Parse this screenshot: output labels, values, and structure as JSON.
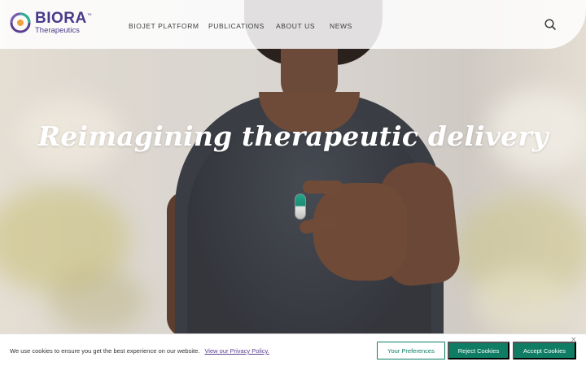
{
  "brand": {
    "name": "BIORA",
    "subtitle": "Therapeutics",
    "trademark": "™"
  },
  "nav": {
    "items": [
      {
        "label": "BIOJET PLATFORM"
      },
      {
        "label": "PUBLICATIONS"
      },
      {
        "label": "ABOUT US"
      },
      {
        "label": "NEWS"
      }
    ],
    "search_icon": "search-icon"
  },
  "hero": {
    "headline": "Reimagining therapeutic delivery"
  },
  "cookie_banner": {
    "message": "We use cookies to ensure you get the best experience on our website.",
    "policy_link": "View our Privacy Policy.",
    "preferences_label": "Your Preferences",
    "reject_label": "Reject Cookies",
    "accept_label": "Accept Cookies",
    "close_label": "×"
  },
  "colors": {
    "brand_purple": "#4a3a8a",
    "accent_green": "#0f7d63"
  }
}
